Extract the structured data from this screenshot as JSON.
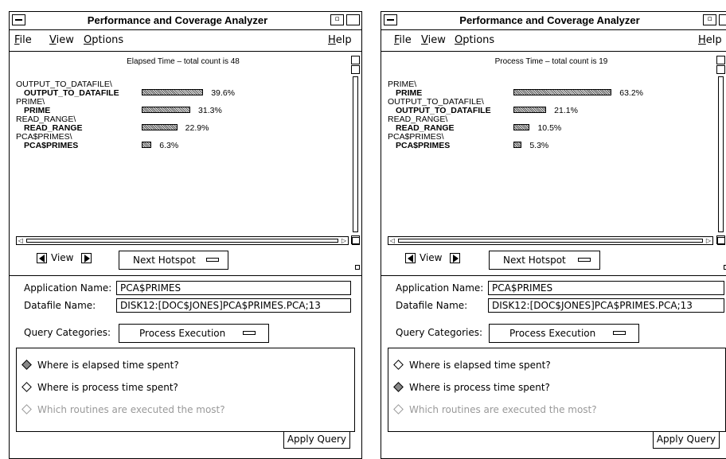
{
  "windows": [
    {
      "title": "Performance and Coverage Analyzer",
      "menu": {
        "file": "File",
        "view": "View",
        "options": "Options",
        "help": "Help"
      },
      "pane_title": "Elapsed Time – total count is 48",
      "rows": [
        {
          "parent": "OUTPUT_TO_DATAFILE\\",
          "child": "OUTPUT_TO_DATAFILE",
          "pct": "39.6%",
          "value": 39.6
        },
        {
          "parent": "PRIME\\",
          "child": "PRIME",
          "pct": "31.3%",
          "value": 31.3
        },
        {
          "parent": "READ_RANGE\\",
          "child": "READ_RANGE",
          "pct": "22.9%",
          "value": 22.9
        },
        {
          "parent": "PCA$PRIMES\\",
          "child": "PCA$PRIMES",
          "pct": "6.3%",
          "value": 6.3
        }
      ],
      "view_label": "View",
      "next_hotspot": "Next Hotspot",
      "app_name_label": "Application Name:",
      "app_name_value": "PCA$PRIMES",
      "datafile_label": "Datafile Name:",
      "datafile_value": "DISK12:[DOC$JONES]PCA$PRIMES.PCA;13",
      "query_label": "Query Categories:",
      "query_value": "Process Execution",
      "radios": [
        {
          "label": "Where is elapsed time spent?",
          "selected": true,
          "dim": false
        },
        {
          "label": "Where is process time spent?",
          "selected": false,
          "dim": false
        },
        {
          "label": "Which routines are executed the most?",
          "selected": false,
          "dim": true
        }
      ],
      "apply": "Apply Query"
    },
    {
      "title": "Performance and Coverage Analyzer",
      "menu": {
        "file": "File",
        "view": "View",
        "options": "Options",
        "help": "Help"
      },
      "pane_title": "Process Time – total count is 19",
      "rows": [
        {
          "parent": "PRIME\\",
          "child": "PRIME",
          "pct": "63.2%",
          "value": 63.2
        },
        {
          "parent": "OUTPUT_TO_DATAFILE\\",
          "child": "OUTPUT_TO_DATAFILE",
          "pct": "21.1%",
          "value": 21.1
        },
        {
          "parent": "READ_RANGE\\",
          "child": "READ_RANGE",
          "pct": "10.5%",
          "value": 10.5
        },
        {
          "parent": "PCA$PRIMES\\",
          "child": "PCA$PRIMES",
          "pct": "5.3%",
          "value": 5.3
        }
      ],
      "view_label": "View",
      "next_hotspot": "Next Hotspot",
      "app_name_label": "Application Name:",
      "app_name_value": "PCA$PRIMES",
      "datafile_label": "Datafile Name:",
      "datafile_value": "DISK12:[DOC$JONES]PCA$PRIMES.PCA;13",
      "query_label": "Query Categories:",
      "query_value": "Process Execution",
      "radios": [
        {
          "label": "Where is elapsed time spent?",
          "selected": false,
          "dim": false
        },
        {
          "label": "Where is process time spent?",
          "selected": true,
          "dim": false
        },
        {
          "label": "Which routines are executed the most?",
          "selected": false,
          "dim": true
        }
      ],
      "apply": "Apply Query"
    }
  ]
}
